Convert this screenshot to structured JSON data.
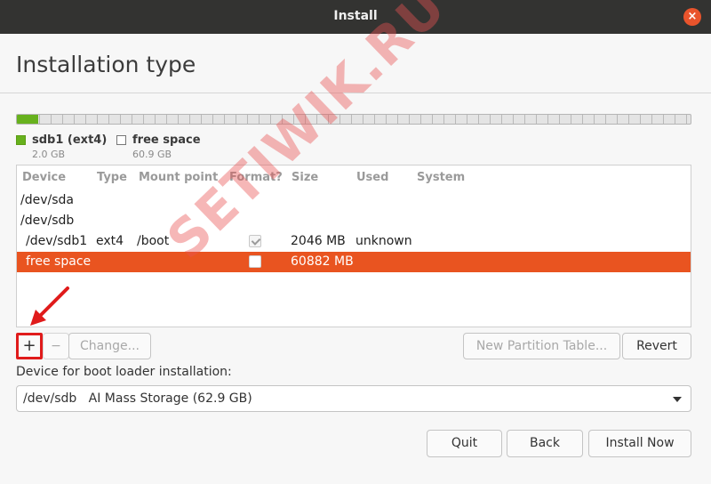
{
  "window": {
    "title": "Install",
    "close_glyph": "×"
  },
  "page": {
    "title": "Installation type"
  },
  "disk": {
    "used_fraction": 0.032,
    "partitions": [
      {
        "name": "sdb1 (ext4)",
        "size": "2.0 GB",
        "color": "#67b11d"
      },
      {
        "name": "free space",
        "size": "60.9 GB",
        "color": "#ffffff"
      }
    ]
  },
  "table": {
    "headers": [
      "Device",
      "Type",
      "Mount point",
      "Format?",
      "Size",
      "Used",
      "System"
    ],
    "rows": [
      {
        "device": "/dev/sda",
        "type": "",
        "mount": "",
        "format": null,
        "size": "",
        "used": "",
        "system": ""
      },
      {
        "device": "/dev/sdb",
        "type": "",
        "mount": "",
        "format": null,
        "size": "",
        "used": "",
        "system": ""
      },
      {
        "device": "/dev/sdb1",
        "type": "ext4",
        "mount": "/boot",
        "format": true,
        "size": "2046 MB",
        "used": "unknown",
        "system": ""
      },
      {
        "device": "free space",
        "type": "",
        "mount": "",
        "format": false,
        "size": "60882 MB",
        "used": "",
        "system": "",
        "selected": true
      }
    ]
  },
  "toolbar": {
    "add_label": "+",
    "remove_label": "−",
    "change_label": "Change...",
    "new_table_label": "New Partition Table...",
    "revert_label": "Revert"
  },
  "bootloader": {
    "label": "Device for boot loader installation:",
    "selected": "/dev/sdb   AI Mass Storage (62.9 GB)"
  },
  "footer": {
    "quit_label": "Quit",
    "back_label": "Back",
    "install_label": "Install Now"
  },
  "watermark": {
    "text": "SETIWIK.RU"
  },
  "colors": {
    "accent": "#e95420",
    "titlebar": "#333331",
    "annotation": "#e01b1b"
  }
}
